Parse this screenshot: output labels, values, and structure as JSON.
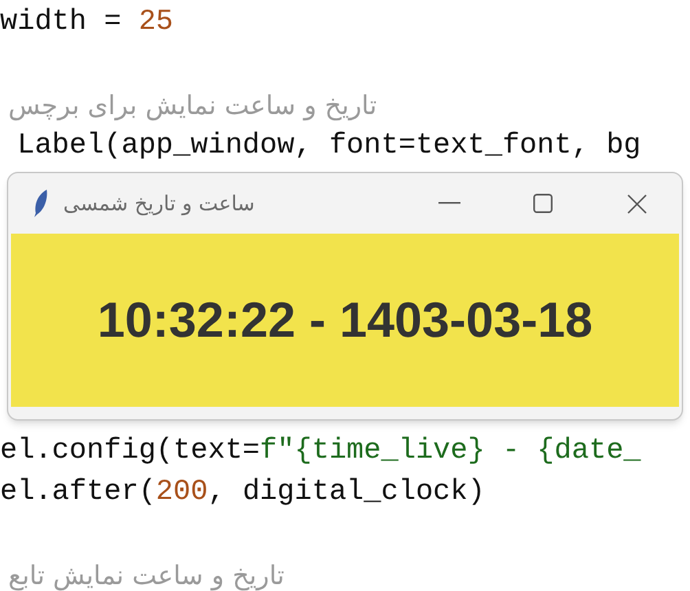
{
  "code_above": [
    {
      "kind": "code",
      "tokens": [
        {
          "text": "width = ",
          "kind": "plain"
        },
        {
          "text": "25",
          "kind": "number"
        }
      ]
    },
    {
      "kind": "blank"
    },
    {
      "kind": "comment",
      "tokens": [
        {
          "text": "تاریخ و ساعت نمایش برای برچس",
          "kind": "comment"
        }
      ]
    },
    {
      "kind": "code",
      "tokens": [
        {
          "text": " Label(app_window, font=text_font, bg",
          "kind": "plain"
        }
      ]
    }
  ],
  "code_below": [
    {
      "kind": "code",
      "tokens": [
        {
          "text": "el.config(text=",
          "kind": "plain"
        },
        {
          "text": "f\"{time_live} - {date_",
          "kind": "string"
        }
      ]
    },
    {
      "kind": "code",
      "tokens": [
        {
          "text": "el.after(",
          "kind": "plain"
        },
        {
          "text": "200",
          "kind": "number"
        },
        {
          "text": ", digital_clock)",
          "kind": "plain"
        }
      ]
    },
    {
      "kind": "blank"
    },
    {
      "kind": "comment",
      "tokens": [
        {
          "text": "تاریخ و ساعت نمایش تابع",
          "kind": "comment"
        }
      ]
    }
  ],
  "window": {
    "title": "ساعت و تاریخ شمسی",
    "clock_text": "10:32:22 - 1403-03-18"
  }
}
